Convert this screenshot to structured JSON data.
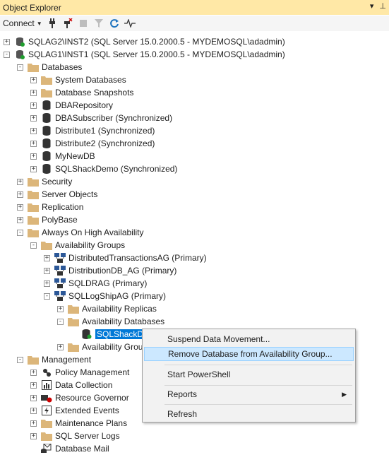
{
  "window": {
    "title": "Object Explorer"
  },
  "toolbar": {
    "connect_label": "Connect"
  },
  "tree": [
    {
      "label": "SQLAG2\\INST2 (SQL Server 15.0.2000.5 - MYDEMOSQL\\adadmin)",
      "icon": "server-icon",
      "expander": "+"
    },
    {
      "label": "SQLAG1\\INST1 (SQL Server 15.0.2000.5 - MYDEMOSQL\\adadmin)",
      "icon": "server-icon",
      "expander": "-"
    },
    {
      "label": "Databases",
      "icon": "folder-icon",
      "expander": "-"
    },
    {
      "label": "System Databases",
      "icon": "folder-icon",
      "expander": "+"
    },
    {
      "label": "Database Snapshots",
      "icon": "folder-icon",
      "expander": "+"
    },
    {
      "label": "DBARepository",
      "icon": "database-icon",
      "expander": "+"
    },
    {
      "label": "DBASubscriber (Synchronized)",
      "icon": "database-icon",
      "expander": "+"
    },
    {
      "label": "Distribute1 (Synchronized)",
      "icon": "database-icon",
      "expander": "+"
    },
    {
      "label": "Distribute2 (Synchronized)",
      "icon": "database-icon",
      "expander": "+"
    },
    {
      "label": "MyNewDB",
      "icon": "database-icon",
      "expander": "+"
    },
    {
      "label": "SQLShackDemo (Synchronized)",
      "icon": "database-icon",
      "expander": "+"
    },
    {
      "label": "Security",
      "icon": "folder-icon",
      "expander": "+"
    },
    {
      "label": "Server Objects",
      "icon": "folder-icon",
      "expander": "+"
    },
    {
      "label": "Replication",
      "icon": "folder-icon",
      "expander": "+"
    },
    {
      "label": "PolyBase",
      "icon": "folder-icon",
      "expander": "+"
    },
    {
      "label": "Always On High Availability",
      "icon": "folder-icon",
      "expander": "-"
    },
    {
      "label": "Availability Groups",
      "icon": "folder-icon",
      "expander": "-"
    },
    {
      "label": "DistributedTransactionsAG (Primary)",
      "icon": "availability-group-icon",
      "expander": "+"
    },
    {
      "label": "DistributionDB_AG (Primary)",
      "icon": "availability-group-icon",
      "expander": "+"
    },
    {
      "label": "SQLDRAG (Primary)",
      "icon": "availability-group-icon",
      "expander": "+"
    },
    {
      "label": "SQLLogShipAG (Primary)",
      "icon": "availability-group-icon",
      "expander": "-"
    },
    {
      "label": "Availability Replicas",
      "icon": "folder-icon",
      "expander": "+"
    },
    {
      "label": "Availability Databases",
      "icon": "folder-icon",
      "expander": "-"
    },
    {
      "label": "SQLShackDe",
      "icon": "availability-database-icon",
      "expander": "",
      "selected": true
    },
    {
      "label": "Availability Grou",
      "icon": "folder-icon",
      "expander": "+"
    },
    {
      "label": "Management",
      "icon": "folder-icon",
      "expander": "-"
    },
    {
      "label": "Policy Management",
      "icon": "policy-icon",
      "expander": "+"
    },
    {
      "label": "Data Collection",
      "icon": "data-collection-icon",
      "expander": "+"
    },
    {
      "label": "Resource Governor",
      "icon": "resource-governor-icon",
      "expander": "+"
    },
    {
      "label": "Extended Events",
      "icon": "extended-events-icon",
      "expander": "+"
    },
    {
      "label": "Maintenance Plans",
      "icon": "folder-icon",
      "expander": "+"
    },
    {
      "label": "SQL Server Logs",
      "icon": "folder-icon",
      "expander": "+"
    },
    {
      "label": "Database Mail",
      "icon": "mail-icon",
      "expander": ""
    }
  ],
  "context_menu": {
    "items": [
      {
        "label": "Suspend Data Movement..."
      },
      {
        "label": "Remove Database from Availability Group...",
        "highlighted": true
      },
      {
        "label": "Start PowerShell"
      },
      {
        "label": "Reports",
        "submenu": true
      },
      {
        "label": "Refresh"
      }
    ]
  },
  "colors": {
    "title_bar": "#ffe8a6",
    "selection": "#0078d7",
    "menu_highlight": "#cce8ff",
    "folder": "#dcb67a"
  }
}
